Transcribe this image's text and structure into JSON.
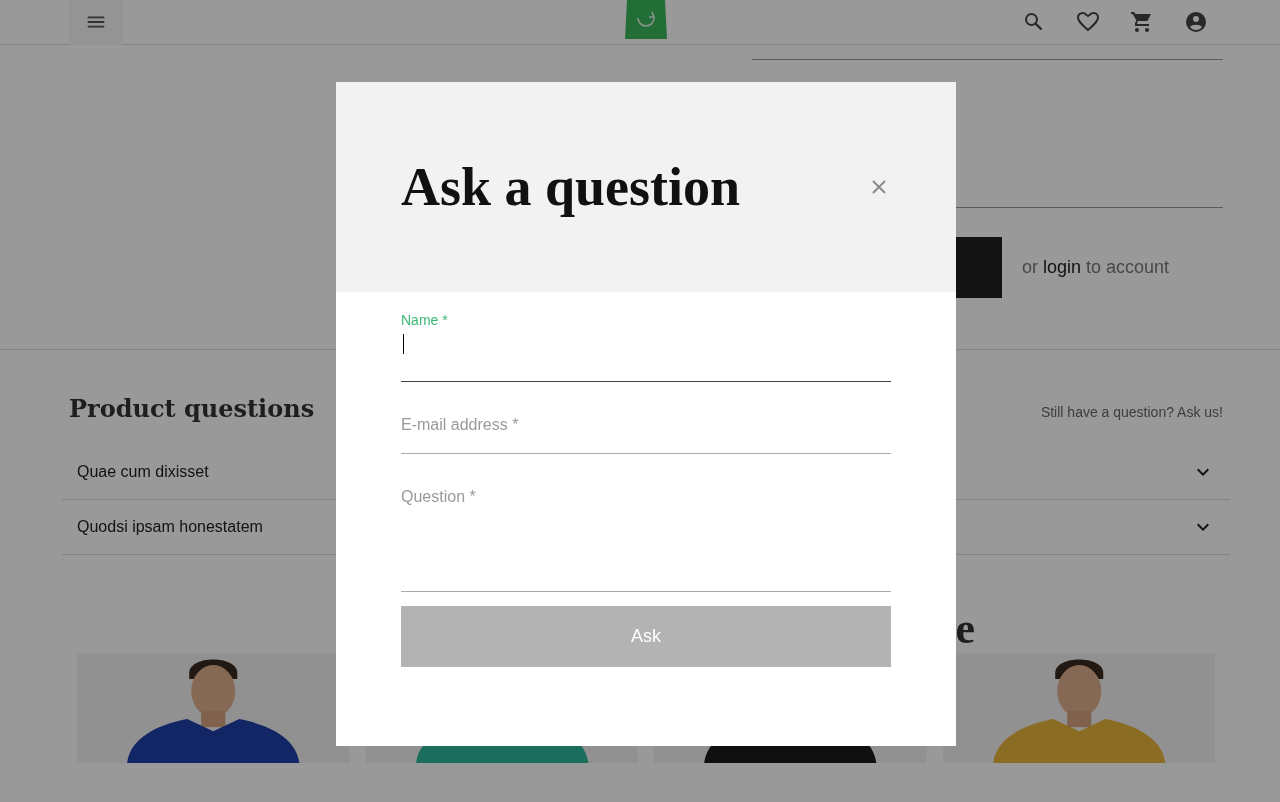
{
  "purchase": {
    "login_note": {
      "before": "or",
      "link": "login",
      "after": "to account"
    }
  },
  "questions": {
    "title": "Product questions",
    "ask_link": "Still have a question? Ask us!",
    "items": [
      {
        "label": "Quae cum dixisset",
        "expanded": false
      },
      {
        "label": "Quodsi ipsam honestatem",
        "expanded": false
      }
    ]
  },
  "related": {
    "heading_fragment": "e"
  },
  "dialog": {
    "title": "Ask a question",
    "fields": [
      {
        "label": "Name *",
        "kind": "input",
        "focused": true
      },
      {
        "label": "E-mail address *",
        "kind": "input",
        "focused": false
      },
      {
        "label": "Question *",
        "kind": "textarea",
        "focused": false
      }
    ],
    "submit": {
      "label": "Ask",
      "disabled": true
    }
  }
}
